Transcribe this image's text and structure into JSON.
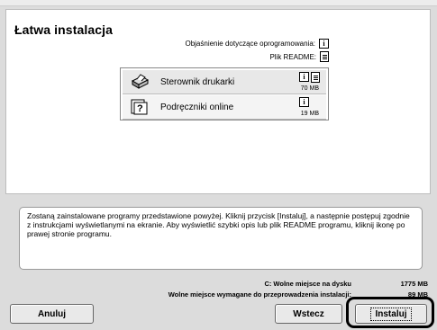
{
  "window": {
    "title": "Łatwa instalacja"
  },
  "info": {
    "software_explanation_label": "Objaśnienie dotyczące oprogramowania:",
    "readme_label": "Plik README:"
  },
  "components": [
    {
      "label": "Sterownik drukarki",
      "size": "70 MB",
      "icon": "printer-icon",
      "has_readme": true
    },
    {
      "label": "Podręczniki online",
      "size": "19 MB",
      "icon": "manual-help-icon",
      "has_readme": false
    }
  ],
  "message": "Zostaną zainstalowane programy przedstawione powyżej. Kliknij przycisk [Instaluj], a następnie postępuj zgodnie z instrukcjami wyświetlanymi na ekranie. Aby wyświetlić szybki opis lub plik README programu, kliknij ikonę po prawej stronie programu.",
  "disk": {
    "free_label": "C: Wolne miejsce na dysku",
    "free_value": "1775 MB",
    "required_label": "Wolne miejsce wymagane do przeprowadzenia instalacji:",
    "required_value": "89 MB"
  },
  "buttons": {
    "cancel": "Anuluj",
    "back": "Wstecz",
    "install": "Instaluj"
  }
}
